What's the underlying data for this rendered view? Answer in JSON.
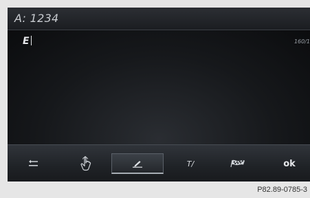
{
  "recipient": {
    "text": "A: 1234"
  },
  "compose": {
    "text": "E",
    "char_count": "160/1"
  },
  "toolbar": {
    "buttons": [
      {
        "name": "back",
        "icon": "back-arrow-icon"
      },
      {
        "name": "handwriting",
        "icon": "touch-hand-icon"
      },
      {
        "name": "edit",
        "icon": "pen-icon",
        "selected": true
      },
      {
        "name": "text-options",
        "icon": "text-cursor-icon",
        "label": "T/"
      },
      {
        "name": "templates",
        "icon": "checkered-flag-icon"
      },
      {
        "name": "ok",
        "label": "ok"
      }
    ]
  },
  "footer": {
    "figure_code": "P82.89-0785-3"
  }
}
